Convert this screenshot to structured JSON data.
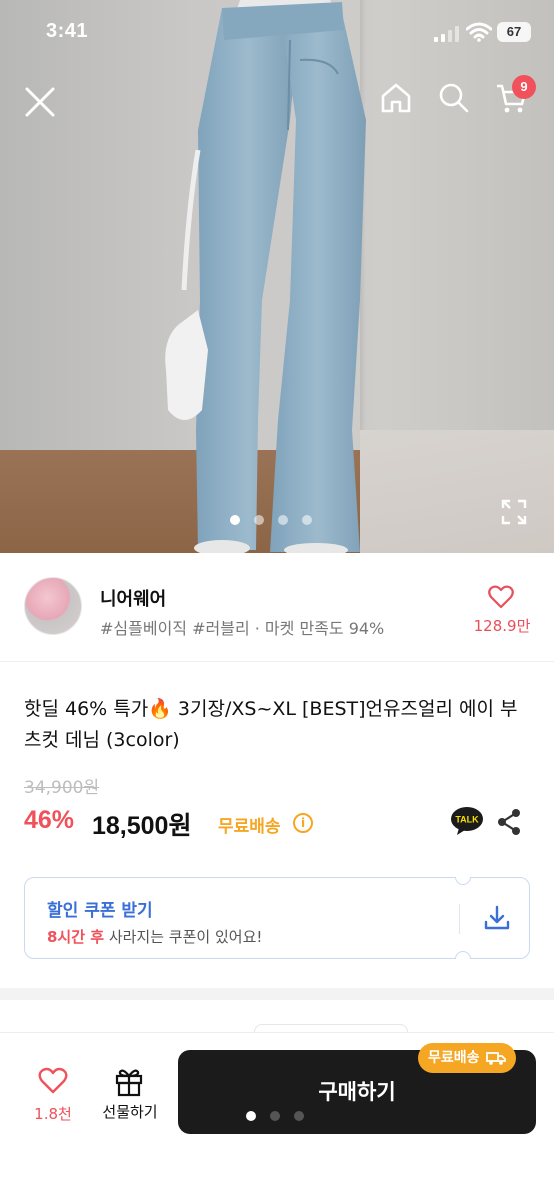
{
  "status_bar": {
    "time": "3:41",
    "battery": "67"
  },
  "header": {
    "cart_count": "9"
  },
  "hero": {
    "image_count": 4,
    "active_index": 0
  },
  "seller": {
    "name": "니어웨어",
    "tags": "#심플베이직 #러블리 · 마켓 만족도 94%",
    "likes": "128.9만"
  },
  "product": {
    "title": "핫딜 46% 특가🔥 3기장/XS~XL [BEST]언유즈얼리 에이 부츠컷 데님 (3color)",
    "original_price": "34,900원",
    "discount": "46%",
    "price": "18,500원",
    "shipping": "무료배송",
    "talk_label": "TALK"
  },
  "coupon": {
    "title": "할인 쿠폰 받기",
    "highlight": "8시간 후",
    "subtitle": " 사라지는 쿠폰이 있어요!"
  },
  "bottom_bar": {
    "like_count": "1.8천",
    "gift_label": "선물하기",
    "buy_label": "구매하기",
    "shipping_badge": "무료배송"
  },
  "colors": {
    "accent": "#f0515b",
    "shipping": "#f5a623",
    "coupon": "#3a6fd8",
    "buy": "#1b1b1b"
  }
}
